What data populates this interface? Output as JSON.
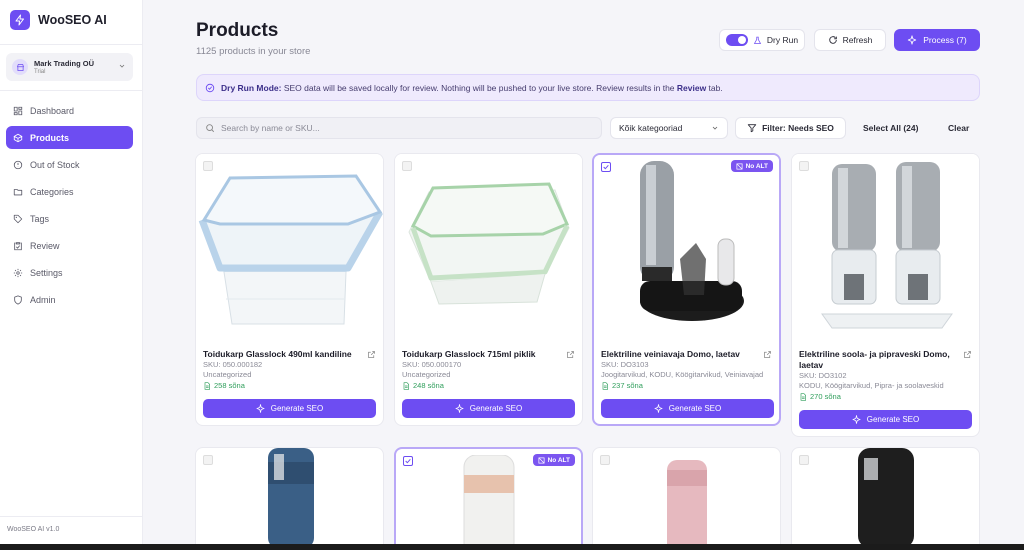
{
  "app": {
    "name": "WooSEO AI",
    "version": "WooSEO AI v1.0"
  },
  "store": {
    "name": "Mark Trading OÜ",
    "plan": "Trial"
  },
  "nav": [
    {
      "label": "Dashboard",
      "icon": "dashboard-icon"
    },
    {
      "label": "Products",
      "icon": "products-icon",
      "active": true
    },
    {
      "label": "Out of Stock",
      "icon": "out-of-stock-icon"
    },
    {
      "label": "Categories",
      "icon": "folder-icon"
    },
    {
      "label": "Tags",
      "icon": "tag-icon"
    },
    {
      "label": "Review",
      "icon": "clipboard-icon"
    },
    {
      "label": "Settings",
      "icon": "gear-icon"
    },
    {
      "label": "Admin",
      "icon": "shield-icon"
    }
  ],
  "header": {
    "title": "Products",
    "subtitle": "1125 products in your store",
    "dry_run_label": "Dry Run",
    "refresh_label": "Refresh",
    "process_label": "Process (7)"
  },
  "banner": {
    "strong": "Dry Run Mode:",
    "text": " SEO data will be saved locally for review. Nothing will be pushed to your live store. Review results in the ",
    "link": "Review",
    "tail": " tab."
  },
  "toolbar": {
    "search_placeholder": "Search by name or SKU...",
    "category_value": "Kõik kategooriad",
    "filter_label": "Filter: Needs SEO",
    "select_all_label": "Select All (24)",
    "clear_label": "Clear"
  },
  "product_labels": {
    "generate": "Generate SEO",
    "no_alt": "No ALT"
  },
  "products": [
    {
      "title": "Toidukarp Glasslock 490ml kandiline",
      "sku": "SKU: 050.000182",
      "category": "Uncategorized",
      "words": "258 sõna",
      "selected": false,
      "no_alt": false
    },
    {
      "title": "Toidukarp Glasslock 715ml piklik",
      "sku": "SKU: 050.000170",
      "category": "Uncategorized",
      "words": "248 sõna",
      "selected": false,
      "no_alt": false
    },
    {
      "title": "Elektriline veiniavaja Domo, laetav",
      "sku": "SKU: DO3103",
      "category": "Joogitarvikud, KODU, Köögitarvikud, Veiniavajad",
      "words": "237 sõna",
      "selected": true,
      "no_alt": true
    },
    {
      "title": "Elektriline soola- ja pipraveski Domo, laetav",
      "sku": "SKU: DO3102",
      "category": "KODU, Köögitarvikud, Pipra- ja soolaveskid",
      "words": "270 sõna",
      "selected": false,
      "no_alt": false
    },
    {
      "title": "",
      "selected": false,
      "no_alt": false
    },
    {
      "title": "",
      "selected": true,
      "no_alt": true
    },
    {
      "title": "",
      "selected": false,
      "no_alt": false
    },
    {
      "title": "",
      "selected": false,
      "no_alt": false
    }
  ],
  "colors": {
    "accent": "#6d4df2",
    "success": "#2f9e5b",
    "banner_bg": "#efeafd"
  }
}
